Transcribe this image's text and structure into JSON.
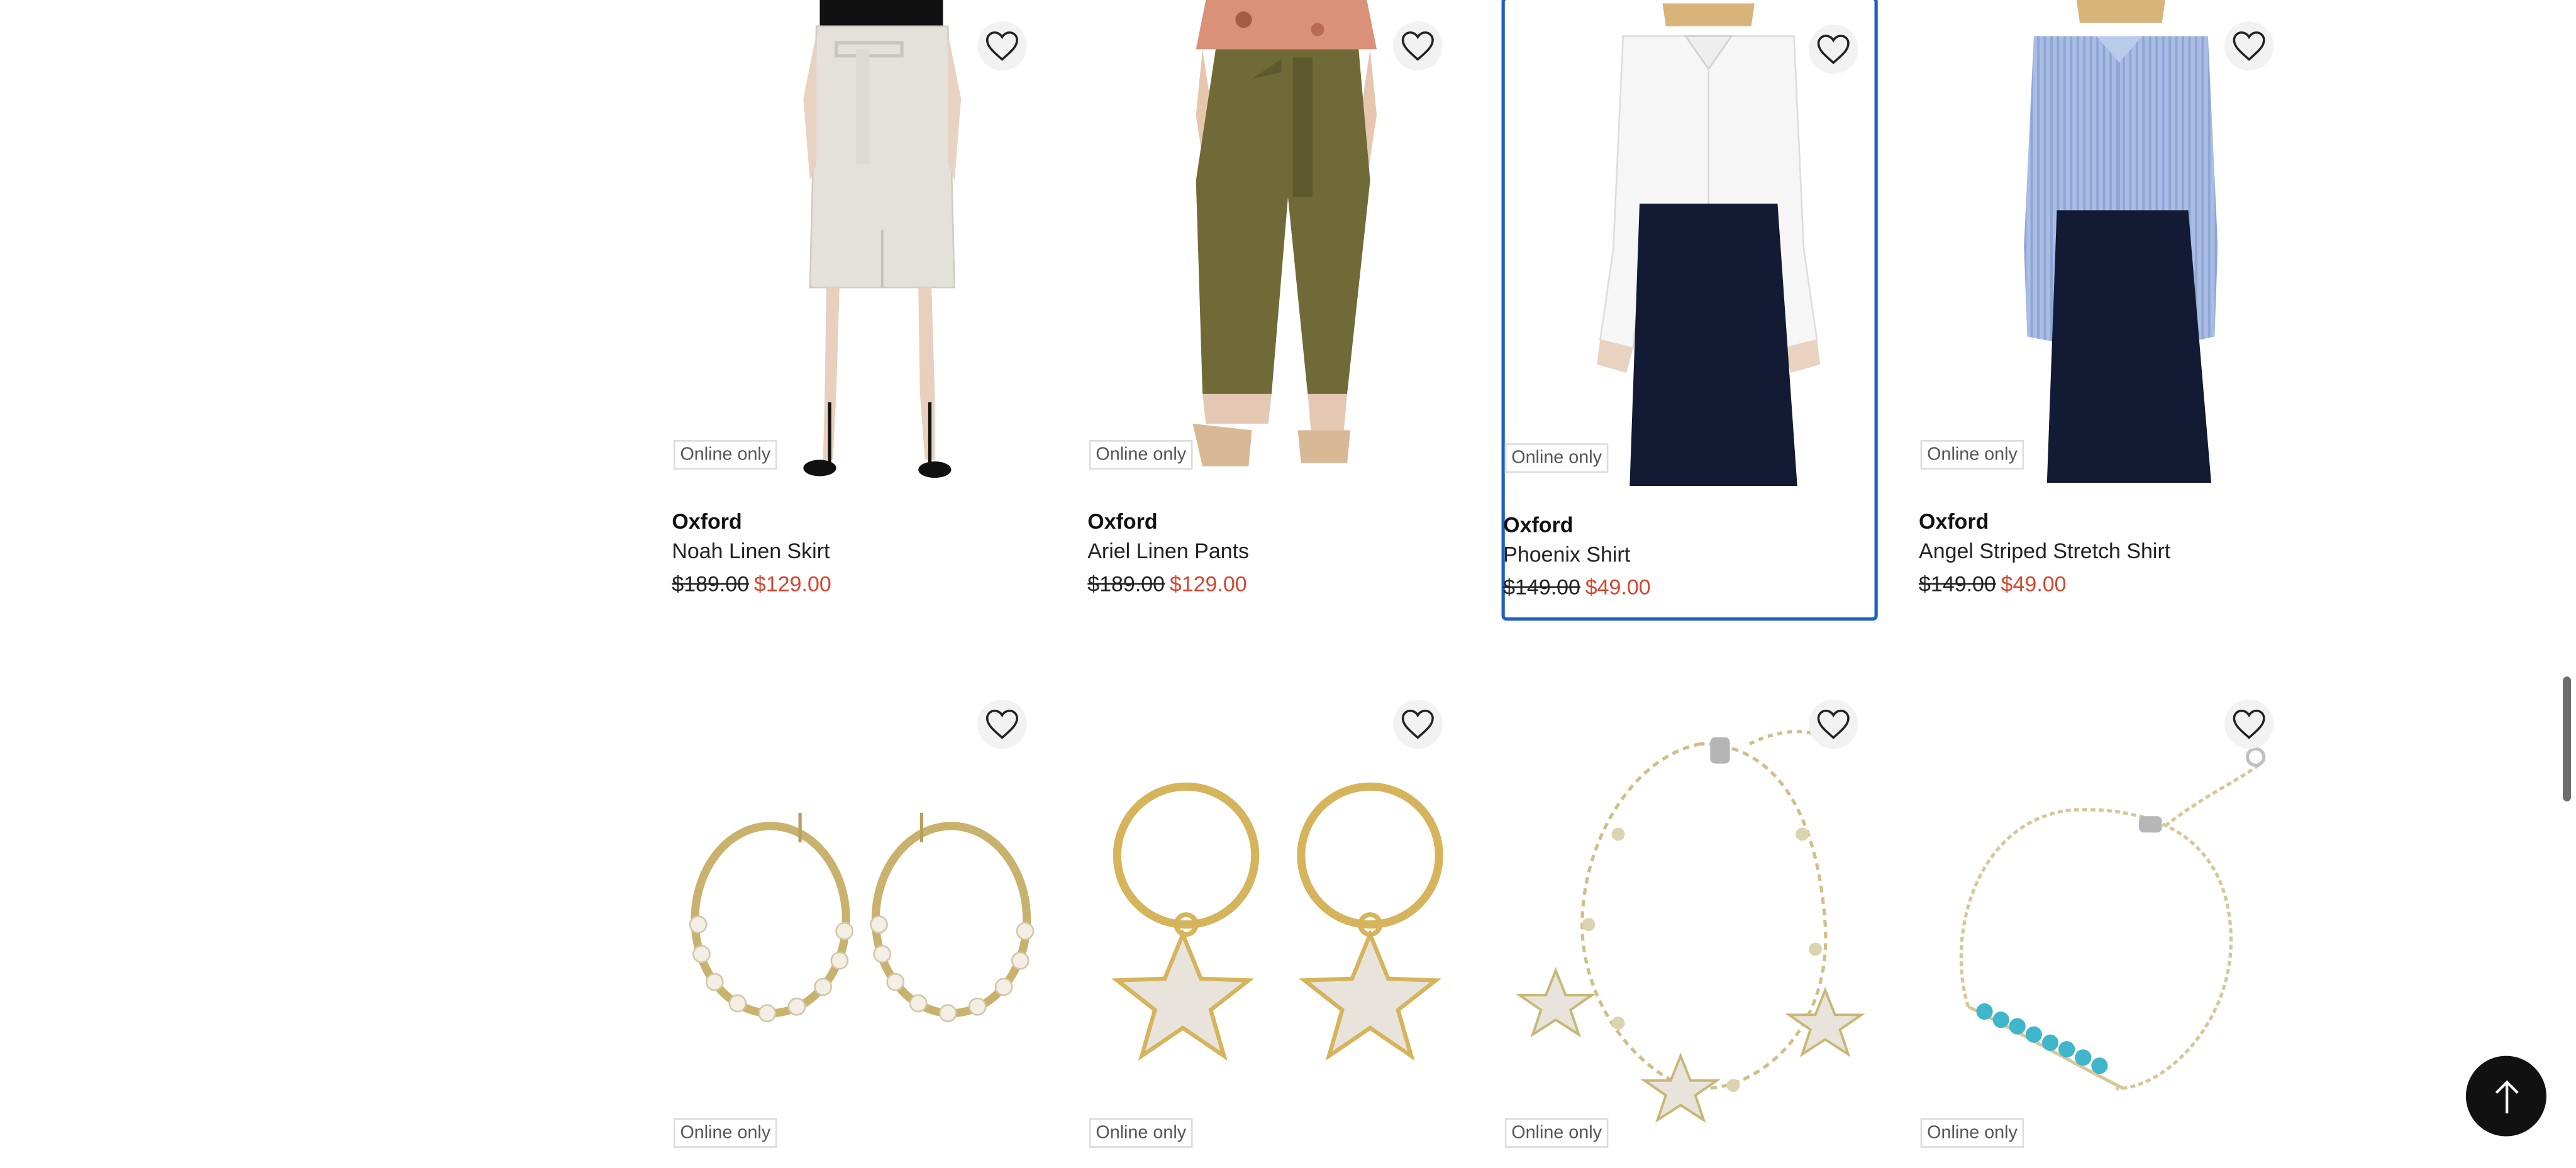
{
  "accent_color": "#1f5fbf",
  "sale_color": "#d64530",
  "products": [
    {
      "badge": "Online only",
      "brand": "Oxford",
      "name": "Noah Linen Skirt",
      "was_price": "$189.00",
      "now_price": "$129.00",
      "icon": "heart-icon"
    },
    {
      "badge": "Online only",
      "brand": "Oxford",
      "name": "Ariel Linen Pants",
      "was_price": "$189.00",
      "now_price": "$129.00",
      "icon": "heart-icon"
    },
    {
      "badge": "Online only",
      "brand": "Oxford",
      "name": "Phoenix Shirt",
      "was_price": "$149.00",
      "now_price": "$49.00",
      "icon": "heart-icon"
    },
    {
      "badge": "Online only",
      "brand": "Oxford",
      "name": "Angel Striped Stretch Shirt",
      "was_price": "$149.00",
      "now_price": "$49.00",
      "icon": "heart-icon"
    },
    {
      "badge": "Online only",
      "icon": "heart-icon"
    },
    {
      "badge": "Online only",
      "icon": "heart-icon"
    },
    {
      "badge": "Online only",
      "icon": "heart-icon"
    },
    {
      "badge": "Online only",
      "icon": "heart-icon"
    }
  ],
  "back_to_top": {
    "icon": "arrow-up-icon"
  }
}
